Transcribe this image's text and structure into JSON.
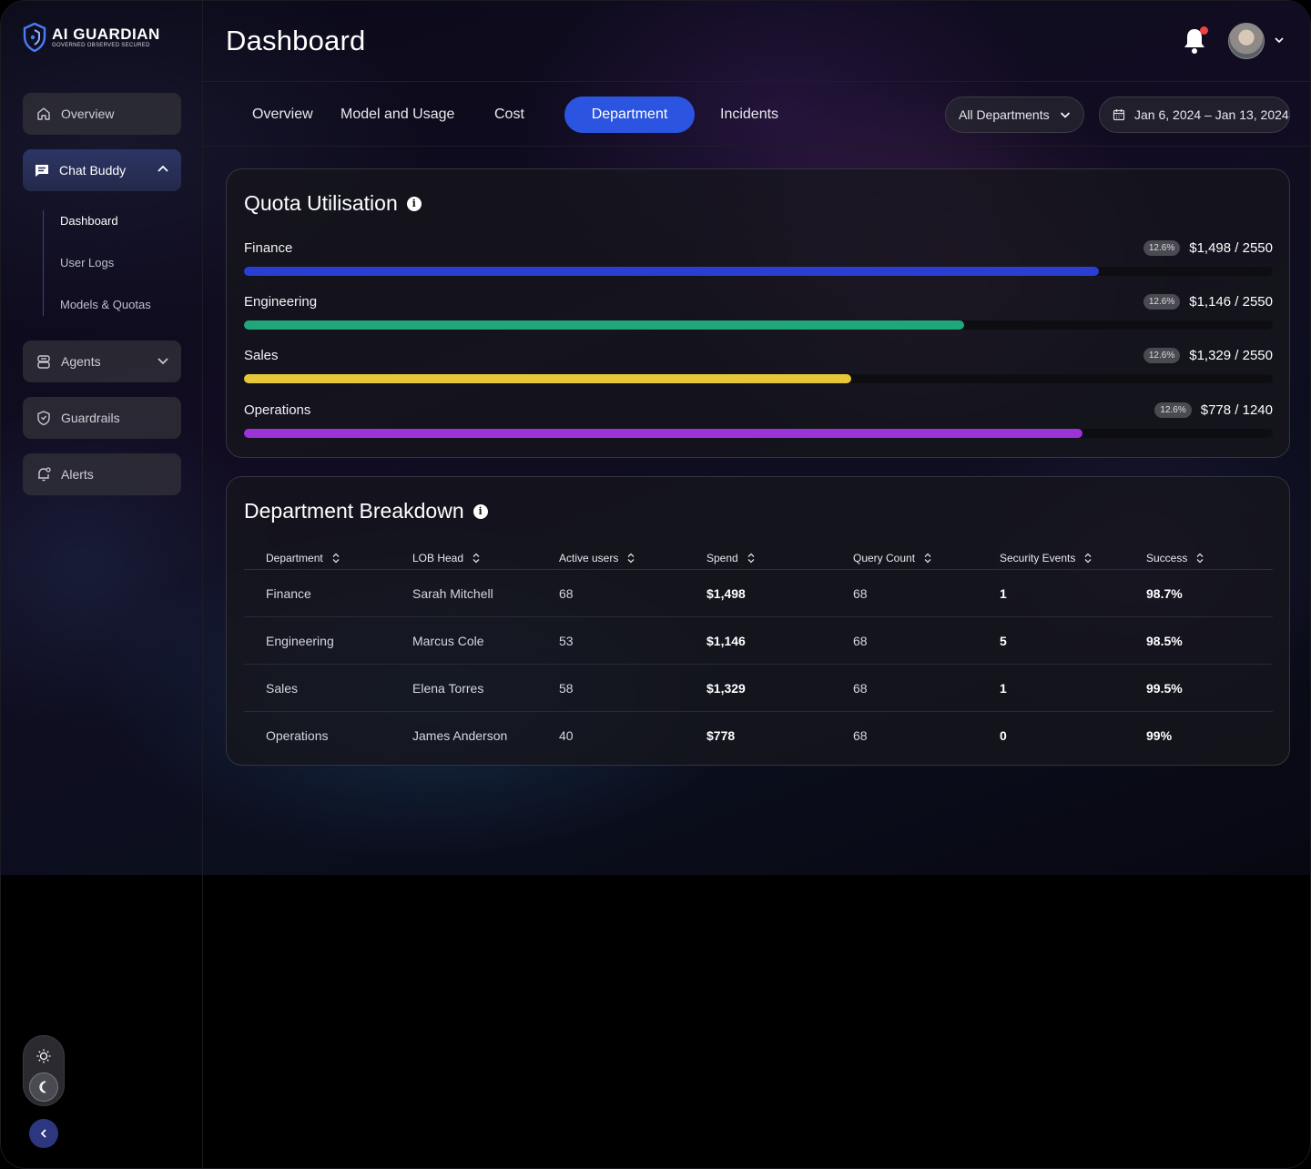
{
  "brand": {
    "name": "AI GUARDIAN",
    "tagline": "GOVERNED OBSERVED SECURED"
  },
  "sidebar": {
    "overview": "Overview",
    "chat_buddy": "Chat Buddy",
    "sub_items": [
      "Dashboard",
      "User Logs",
      "Models & Quotas"
    ],
    "agents": "Agents",
    "guardrails": "Guardrails",
    "alerts": "Alerts"
  },
  "header": {
    "title": "Dashboard",
    "notification_dot_color": "#ef4444"
  },
  "tabs": [
    "Overview",
    "Model and Usage",
    "Cost",
    "Department",
    "Incidents"
  ],
  "active_tab": "Department",
  "filters": {
    "department": "All Departments",
    "date_range": "Jan 6, 2024 – Jan 13, 2024"
  },
  "quota": {
    "title": "Quota Utilisation",
    "rows": [
      {
        "label": "Finance",
        "pct": "12.6%",
        "value": "$1,498 / 2550",
        "fill": 0.831,
        "color": "#2a3ed1"
      },
      {
        "label": "Engineering",
        "pct": "12.6%",
        "value": "$1,146 / 2550",
        "fill": 0.7,
        "color": "#1fa77b"
      },
      {
        "label": "Sales",
        "pct": "12.6%",
        "value": "$1,329 / 2550",
        "fill": 0.59,
        "color": "#e6c739"
      },
      {
        "label": "Operations",
        "pct": "12.6%",
        "value": "$778 / 1240",
        "fill": 0.815,
        "color": "#9a34d6"
      }
    ]
  },
  "breakdown": {
    "title": "Department Breakdown",
    "columns": [
      "Department",
      "LOB Head",
      "Active users",
      "Spend",
      "Query Count",
      "Security Events",
      "Success"
    ],
    "rows": [
      [
        "Finance",
        "Sarah Mitchell",
        "68",
        "$1,498",
        "68",
        "1",
        "98.7%"
      ],
      [
        "Engineering",
        "Marcus Cole",
        "53",
        "$1,146",
        "68",
        "5",
        "98.5%"
      ],
      [
        "Sales",
        "Elena Torres",
        "58",
        "$1,329",
        "68",
        "1",
        "99.5%"
      ],
      [
        "Operations",
        "James Anderson",
        "40",
        "$778",
        "68",
        "0",
        "99%"
      ]
    ]
  },
  "colors": {
    "accent": "#2b54e0",
    "background": "#000000"
  }
}
